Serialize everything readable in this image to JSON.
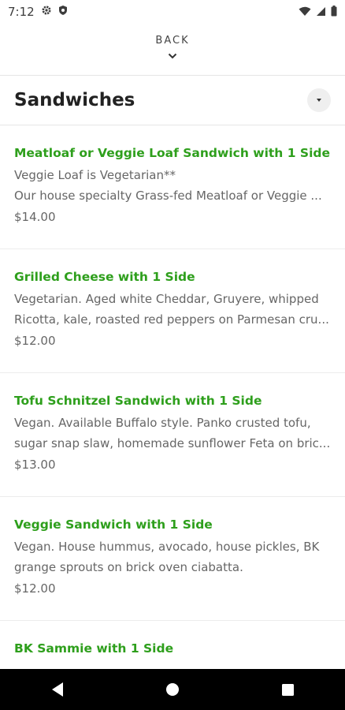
{
  "status_bar": {
    "time": "7:12"
  },
  "header": {
    "back_label": "BACK"
  },
  "section": {
    "title": "Sandwiches"
  },
  "items": [
    {
      "name": "Meatloaf or Veggie Loaf Sandwich with 1 Side",
      "desc_line1": "Veggie Loaf is Vegetarian**",
      "desc_line2": "Our house specialty Grass-fed Meatloaf or Veggie ...",
      "price": "$14.00"
    },
    {
      "name": "Grilled Cheese with 1 Side",
      "desc_line1": "Vegetarian. Aged white Cheddar, Gruyere, whipped",
      "desc_line2": "Ricotta, kale, roasted red peppers on Parmesan cru...",
      "price": "$12.00"
    },
    {
      "name": "Tofu Schnitzel Sandwich with 1 Side",
      "desc_line1": "Vegan. Available Buffalo style. Panko crusted tofu,",
      "desc_line2": "sugar snap slaw, homemade sunflower Feta on bric...",
      "price": "$13.00"
    },
    {
      "name": "Veggie Sandwich with 1 Side",
      "desc_line1": "Vegan. House hummus, avocado, house pickles, BK",
      "desc_line2": "grange sprouts on brick oven ciabatta.",
      "price": "$12.00"
    },
    {
      "name": "BK Sammie with 1 Side",
      "desc_line1": "",
      "desc_line2": "",
      "price": ""
    }
  ],
  "colors": {
    "accent": "#2e9f1c",
    "text_secondary": "#666666",
    "nav_bg": "#000000"
  },
  "icons": [
    "settings-icon",
    "shield-icon",
    "wifi-icon",
    "signal-icon",
    "battery-icon",
    "chevron-down-icon",
    "back-triangle-icon",
    "home-circle-icon",
    "recents-square-icon"
  ]
}
